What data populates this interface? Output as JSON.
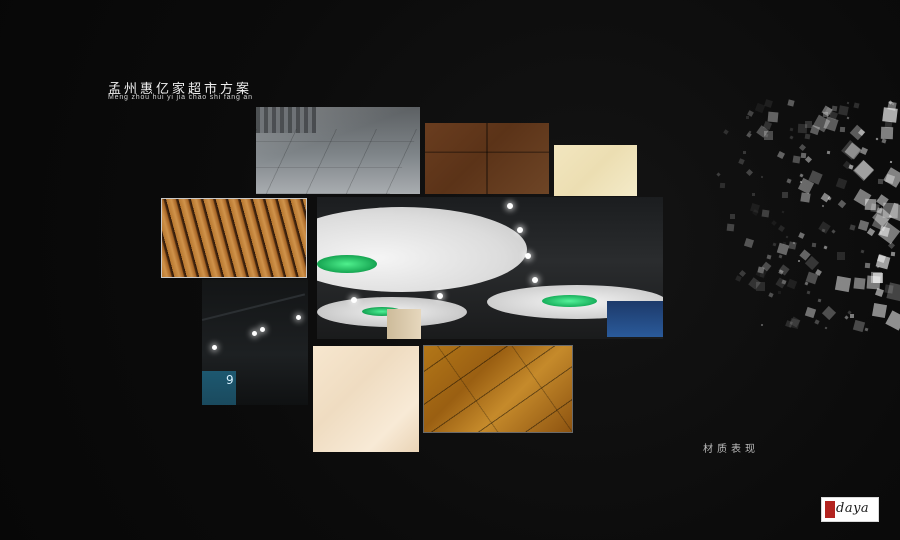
{
  "header": {
    "title": "孟州惠亿家超市方案",
    "subtitle": "Meng zhou hui yi jia chao shi fang an"
  },
  "section": {
    "label": "材质表现"
  },
  "store_photo": {
    "sign_text": "9"
  },
  "logo": {
    "text": "daya"
  },
  "colors": {
    "background": "#0b0b0b",
    "title_text": "#f1f1f1",
    "accent_green": "#2fd67a",
    "logo_red": "#b32420"
  },
  "materials": [
    {
      "name": "floor-photo",
      "icon": "photo"
    },
    {
      "name": "brown-tile",
      "icon": "swatch"
    },
    {
      "name": "cream-tile",
      "icon": "swatch"
    },
    {
      "name": "wood-slats",
      "icon": "swatch"
    },
    {
      "name": "ceiling-photo",
      "icon": "photo"
    },
    {
      "name": "store-photo",
      "icon": "photo"
    },
    {
      "name": "beige-tile",
      "icon": "swatch"
    },
    {
      "name": "wood-floor",
      "icon": "swatch"
    }
  ]
}
